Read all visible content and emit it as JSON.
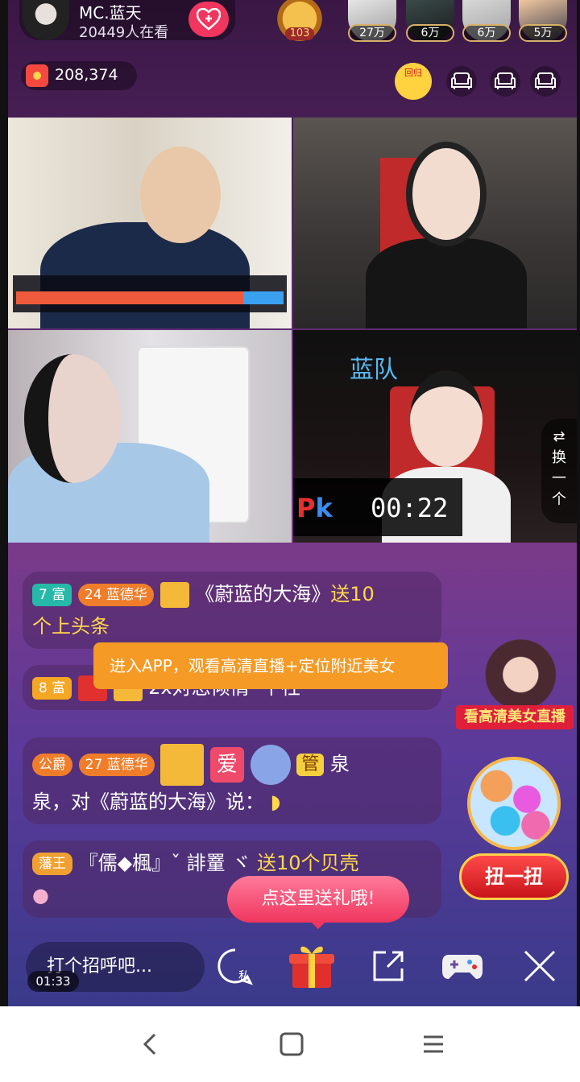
{
  "host": {
    "name": "MC.蓝天",
    "viewers": "20449人在看"
  },
  "rank_badge": "103",
  "top_viewers": [
    {
      "count": "27万"
    },
    {
      "count": "6万"
    },
    {
      "count": "6万"
    },
    {
      "count": "5万"
    }
  ],
  "coins": "208,374",
  "return_badge": "回归",
  "colors": {
    "accent": "#f0365e",
    "gold": "#ffd84a",
    "team_blue": "#5ab8f0",
    "orange": "#f59a24"
  },
  "pk": {
    "team_label": "蓝队",
    "timer": "00:22",
    "logo_p": "P",
    "logo_k": "k"
  },
  "switch_btn": {
    "line1": "换",
    "line2": "一",
    "line3": "个"
  },
  "chat": [
    {
      "badge_fortune": "7 富",
      "badge_level": "24",
      "badge_name": "蓝德华",
      "text_main": "《蔚蓝的大海》",
      "text_gift": "送10",
      "text_line2": "个上头条"
    },
    {
      "badge_fortune": "8 富",
      "text": "2x对您倾情 ·个社"
    },
    {
      "badge_gong": "公爵",
      "badge_level": "27",
      "badge_name": "蓝德华",
      "badge_ai": "爱",
      "badge_guan": "管",
      "text_end": "泉",
      "text_line2": "泉，对《蔚蓝的大海》说："
    },
    {
      "badge_king": "藩王",
      "text_name": "『儒◆楓』ˇ 誹罿 ヾ",
      "text_gift": "送10个贝壳"
    }
  ],
  "tooltip_app": "进入APP，观看高清直播+定位附近美女",
  "promo_text": "看高清美女直播",
  "gacha_btn": "扭一扭",
  "gift_tip": "点这里送礼哦!",
  "input_placeholder": "打个招呼吧...",
  "elapsed": "01:33",
  "private_label": "私"
}
